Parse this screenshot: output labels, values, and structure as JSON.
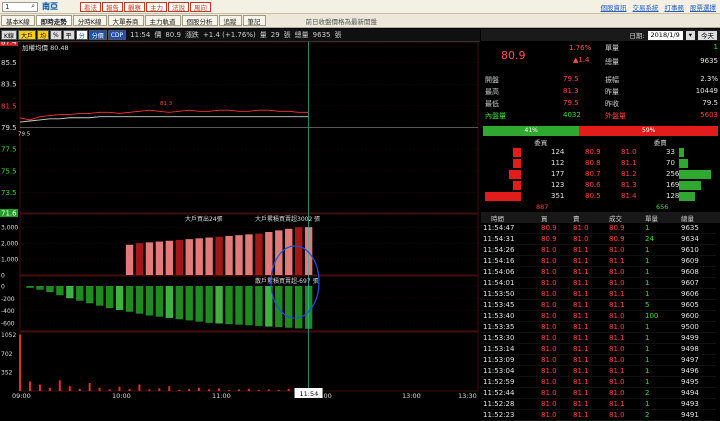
{
  "topbar": {
    "selector_value": "1",
    "stock_name": "南亞",
    "buttons": [
      "看法",
      "報告",
      "觀察",
      "主力",
      "法說",
      "風向"
    ],
    "links": [
      "個股資訊",
      "交易系統",
      "打事務",
      "股票選擇"
    ]
  },
  "tabs": [
    "基本K線",
    "即時走勢",
    "分時K線",
    "大單券商",
    "主力軌道",
    "個股分析",
    "追蹤",
    "筆記"
  ],
  "active_tab": 1,
  "notice": "前日收盤價格為最新開盤",
  "toolbar": {
    "buttons": [
      "K線",
      "大戶",
      "均",
      "%",
      "平",
      "分",
      "分價",
      "CDP"
    ],
    "time": "11:54",
    "price_label": "價",
    "price": "80.9",
    "change_label": "漲跌",
    "change": "+1.4 (+1.76%)",
    "volume_label": "量",
    "volume": "29",
    "volume_unit": "張",
    "total_label": "總量",
    "total": "9635",
    "total_unit": "張"
  },
  "chart_data": [
    {
      "type": "line",
      "title": "加權均價 80.48",
      "y_ticks": [
        "87.4",
        "85.5",
        "83.5",
        "81.5",
        "79.5",
        "77.5",
        "75.5",
        "73.5",
        "71.6"
      ],
      "price_marker": "81.3",
      "ref_price_label": "79.5",
      "x_ticks": [
        "09:00",
        "10:00",
        "11:00",
        "12:00",
        "13:00",
        "13:30"
      ],
      "series": [
        {
          "values": [
            80.4,
            80.2,
            80.5,
            80.6,
            80.7,
            80.7,
            80.8,
            80.8,
            80.9,
            80.9,
            80.8,
            80.9,
            81.0,
            81.1,
            81.0,
            80.9,
            81.0,
            81.1,
            81.0,
            81.0,
            81.1,
            81.1,
            81.0,
            81.0,
            81.1,
            81.1,
            81.0,
            81.0,
            80.9,
            80.9
          ]
        },
        {
          "values": [
            80.0,
            80.1,
            80.2,
            80.3,
            80.3,
            80.4,
            80.4,
            80.4,
            80.5,
            80.5,
            80.5,
            80.5,
            80.5,
            80.5,
            80.5,
            80.5,
            80.5,
            80.5,
            80.5,
            80.5,
            80.5,
            80.5,
            80.5,
            80.5,
            80.5,
            80.5,
            80.5,
            80.5,
            80.5,
            80.5
          ]
        }
      ]
    },
    {
      "type": "bar",
      "title": "大戶買出24張",
      "title2": "大戶累積買賣超3002 張",
      "y_ticks": [
        "3,000",
        "2,000",
        "1,000",
        "0"
      ],
      "values": [
        0,
        0,
        0,
        0,
        0,
        0,
        0,
        0,
        0,
        0,
        0,
        1900,
        2000,
        2050,
        2100,
        2150,
        2200,
        2250,
        2300,
        2350,
        2400,
        2450,
        2500,
        2550,
        2600,
        2700,
        2800,
        2900,
        3000,
        3002
      ]
    },
    {
      "type": "bar",
      "title": "散戶累積買賣超-697 張",
      "y_ticks": [
        "0",
        "-200",
        "-400",
        "-600"
      ],
      "values": [
        0,
        -30,
        -60,
        -100,
        -150,
        -200,
        -240,
        -280,
        -320,
        -360,
        -390,
        -420,
        -450,
        -480,
        -500,
        -520,
        -540,
        -560,
        -580,
        -600,
        -610,
        -620,
        -630,
        -640,
        -650,
        -660,
        -670,
        -680,
        -690,
        -697
      ]
    },
    {
      "type": "bar",
      "y_ticks": [
        "1052",
        "702",
        "352"
      ],
      "values": [
        1052,
        180,
        120,
        60,
        200,
        90,
        40,
        150,
        60,
        30,
        80,
        40,
        120,
        30,
        50,
        90,
        20,
        40,
        60,
        30,
        50,
        20,
        30,
        40,
        20,
        30,
        20,
        40,
        30,
        29
      ]
    }
  ],
  "current_time_label": "11:54",
  "quote": {
    "date_label": "日期:",
    "date": "2018/1/9",
    "today_button": "今天",
    "price": "80.9",
    "change_pct": "1.76%",
    "change": "▲1.4",
    "lot_label": "單量",
    "lot": "1",
    "total_label": "總量",
    "total": "9635"
  },
  "stats": [
    {
      "label": "開盤",
      "value": "79.5",
      "label2": "振幅",
      "value2": "2.3%"
    },
    {
      "label": "最高",
      "value": "81.3",
      "label2": "昨量",
      "value2": "10449"
    },
    {
      "label": "最低",
      "value": "79.5",
      "label2": "昨收",
      "value2": "79.5"
    },
    {
      "label": "內盤量",
      "value": "4032",
      "label2": "外盤量",
      "value2": "5603"
    }
  ],
  "ratio": {
    "buy_pct": 41,
    "sell_pct": 59,
    "buy_label": "41%",
    "sell_label": "59%"
  },
  "depth_headers": [
    "委買",
    "委賣"
  ],
  "depth": [
    {
      "bid_qty": "124",
      "bid": "80.9",
      "ask": "81.0",
      "ask_qty": "33",
      "bid_bar": 0.2,
      "ask_bar": 0.15
    },
    {
      "bid_qty": "112",
      "bid": "80.8",
      "ask": "81.1",
      "ask_qty": "70",
      "bid_bar": 0.2,
      "ask_bar": 0.25
    },
    {
      "bid_qty": "177",
      "bid": "80.7",
      "ask": "81.2",
      "ask_qty": "256",
      "bid_bar": 0.3,
      "ask_bar": 0.9
    },
    {
      "bid_qty": "123",
      "bid": "80.6",
      "ask": "81.3",
      "ask_qty": "169",
      "bid_bar": 0.2,
      "ask_bar": 0.6
    },
    {
      "bid_qty": "351",
      "bid": "80.5",
      "ask": "81.4",
      "ask_qty": "128",
      "bid_bar": 0.9,
      "ask_bar": 0.45
    }
  ],
  "depth_totals": {
    "bid": "887",
    "ask": "656"
  },
  "tick_headers": [
    "時間",
    "買",
    "賣",
    "成交",
    "單量",
    "總量"
  ],
  "ticks": [
    {
      "t": "11:54:47",
      "b": "80.9",
      "s": "81.0",
      "p": "80.9",
      "q": "1",
      "v": "9635"
    },
    {
      "t": "11:54:31",
      "b": "80.9",
      "s": "81.0",
      "p": "80.9",
      "q": "24",
      "v": "9634"
    },
    {
      "t": "11:54:26",
      "b": "81.0",
      "s": "81.1",
      "p": "81.0",
      "q": "1",
      "v": "9610"
    },
    {
      "t": "11:54:16",
      "b": "81.0",
      "s": "81.1",
      "p": "81.1",
      "q": "1",
      "v": "9609"
    },
    {
      "t": "11:54:06",
      "b": "81.0",
      "s": "81.1",
      "p": "81.0",
      "q": "1",
      "v": "9608"
    },
    {
      "t": "11:54:01",
      "b": "81.0",
      "s": "81.1",
      "p": "81.0",
      "q": "1",
      "v": "9607"
    },
    {
      "t": "11:53:50",
      "b": "81.0",
      "s": "81.1",
      "p": "81.1",
      "q": "1",
      "v": "9606"
    },
    {
      "t": "11:53:45",
      "b": "81.0",
      "s": "81.1",
      "p": "81.1",
      "q": "5",
      "v": "9605"
    },
    {
      "t": "11:53:40",
      "b": "81.0",
      "s": "81.1",
      "p": "81.0",
      "q": "100",
      "v": "9600"
    },
    {
      "t": "11:53:35",
      "b": "81.0",
      "s": "81.1",
      "p": "81.0",
      "q": "1",
      "v": "9500"
    },
    {
      "t": "11:53:30",
      "b": "81.0",
      "s": "81.1",
      "p": "81.1",
      "q": "1",
      "v": "9499"
    },
    {
      "t": "11:53:14",
      "b": "81.0",
      "s": "81.1",
      "p": "81.0",
      "q": "1",
      "v": "9498"
    },
    {
      "t": "11:53:09",
      "b": "81.0",
      "s": "81.1",
      "p": "81.0",
      "q": "1",
      "v": "9497"
    },
    {
      "t": "11:53:04",
      "b": "81.0",
      "s": "81.1",
      "p": "81.1",
      "q": "1",
      "v": "9496"
    },
    {
      "t": "11:52:59",
      "b": "81.0",
      "s": "81.1",
      "p": "81.0",
      "q": "1",
      "v": "9495"
    },
    {
      "t": "11:52:44",
      "b": "81.0",
      "s": "81.1",
      "p": "81.0",
      "q": "2",
      "v": "9494"
    },
    {
      "t": "11:52:28",
      "b": "81.0",
      "s": "81.1",
      "p": "81.1",
      "q": "1",
      "v": "9493"
    },
    {
      "t": "11:52:23",
      "b": "81.0",
      "s": "81.1",
      "p": "81.0",
      "q": "2",
      "v": "9491"
    }
  ]
}
